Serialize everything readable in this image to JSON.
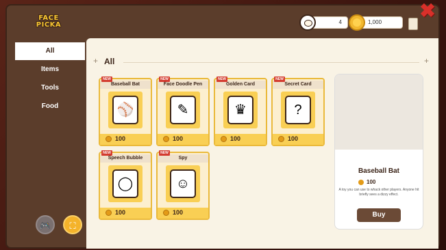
{
  "header": {
    "logo_line1": "FACE",
    "logo_line2": "PICKA",
    "faces_count": "4",
    "coins": "1,000"
  },
  "sidebar": {
    "items": [
      {
        "label": "All",
        "active": true
      },
      {
        "label": "Items",
        "active": false
      },
      {
        "label": "Tools",
        "active": false
      },
      {
        "label": "Food",
        "active": false
      }
    ],
    "bottom_buttons": [
      {
        "icon": "gamepad-icon"
      },
      {
        "icon": "shop-icon"
      }
    ]
  },
  "content": {
    "section_title": "All",
    "cards": [
      {
        "name": "Baseball Bat",
        "badge": "NEW",
        "price": "100",
        "icon": "baseball-bat-icon",
        "glyph": "⚾"
      },
      {
        "name": "Face Doodle Pen",
        "badge": "NEW",
        "price": "100",
        "icon": "pen-icon",
        "glyph": "✎"
      },
      {
        "name": "Golden Card",
        "badge": "NEW",
        "price": "100",
        "icon": "golden-card-icon",
        "glyph": "♛"
      },
      {
        "name": "Secret Card",
        "badge": "NEW",
        "price": "100",
        "icon": "secret-card-icon",
        "glyph": "?"
      },
      {
        "name": "Speech Bubble",
        "badge": "NEW",
        "price": "100",
        "icon": "speech-bubble-icon",
        "glyph": "◯"
      },
      {
        "name": "Spy",
        "badge": "NEW",
        "price": "100",
        "icon": "spy-icon",
        "glyph": "☺"
      }
    ]
  },
  "detail": {
    "name": "Baseball Bat",
    "price": "100",
    "description": "A toy you can use to whack other players. Anyone hit briefly sees a dizzy effect.",
    "buy_label": "Buy"
  }
}
